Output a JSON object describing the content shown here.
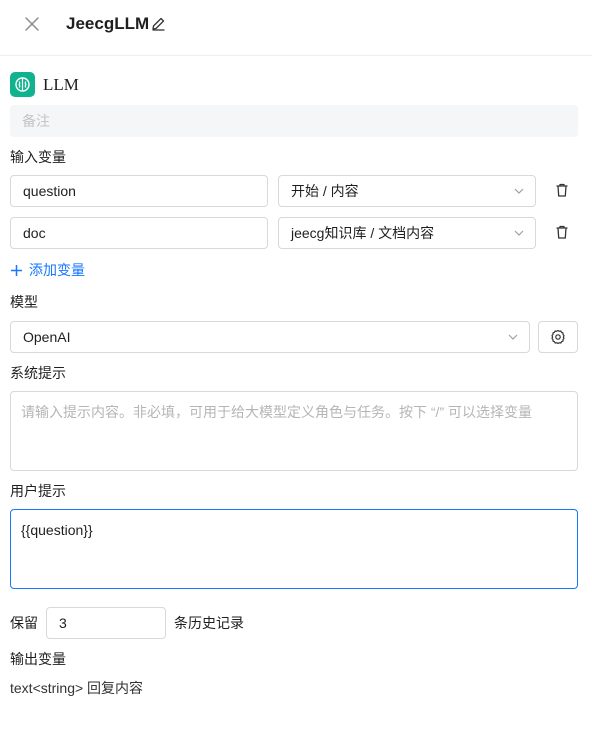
{
  "header": {
    "title": "JeecgLLM"
  },
  "node": {
    "type_label": "LLM",
    "remark_placeholder": "备注"
  },
  "input_vars": {
    "label": "输入变量",
    "rows": [
      {
        "name": "question",
        "source": "开始 / 内容"
      },
      {
        "name": "doc",
        "source": "jeecg知识库 / 文档内容"
      }
    ],
    "add_label": "添加变量"
  },
  "model": {
    "label": "模型",
    "selected": "OpenAI"
  },
  "system_prompt": {
    "label": "系统提示",
    "placeholder": "请输入提示内容。非必填，可用于给大模型定义角色与任务。按下 “/” 可以选择变量"
  },
  "user_prompt": {
    "label": "用户提示",
    "value": "{{question}}"
  },
  "history": {
    "prefix": "保留",
    "value": "3",
    "suffix": "条历史记录"
  },
  "output_vars": {
    "label": "输出变量",
    "text": "text<string> 回复内容"
  },
  "colors": {
    "accent": "#1677ff",
    "node_icon_bg": "#11b38f"
  },
  "icons": [
    "close-icon",
    "edit-icon",
    "brain-icon",
    "chevron-down-icon",
    "trash-icon",
    "plus-icon",
    "gear-icon"
  ]
}
